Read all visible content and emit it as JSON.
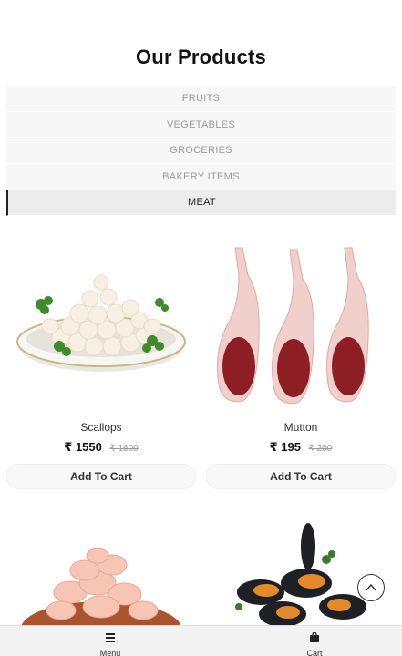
{
  "page": {
    "title": "Our Products"
  },
  "categories": [
    {
      "label": "FRUITS",
      "active": false
    },
    {
      "label": "VEGETABLES",
      "active": false
    },
    {
      "label": "GROCERIES",
      "active": false
    },
    {
      "label": "BAKERY ITEMS",
      "active": false
    },
    {
      "label": "MEAT",
      "active": true
    }
  ],
  "products": [
    {
      "name": "Scallops",
      "price": "₹ 1550",
      "old_price": "₹ 1600",
      "cta": "Add To Cart"
    },
    {
      "name": "Mutton",
      "price": "₹ 195",
      "old_price": "₹ 200",
      "cta": "Add To Cart"
    }
  ],
  "bottom_nav": {
    "menu_label": "Menu",
    "cart_label": "Cart"
  },
  "icons": {
    "menu": "hamburger-icon",
    "cart": "shopping-bag-icon",
    "scroll_top": "chevron-up-icon"
  }
}
